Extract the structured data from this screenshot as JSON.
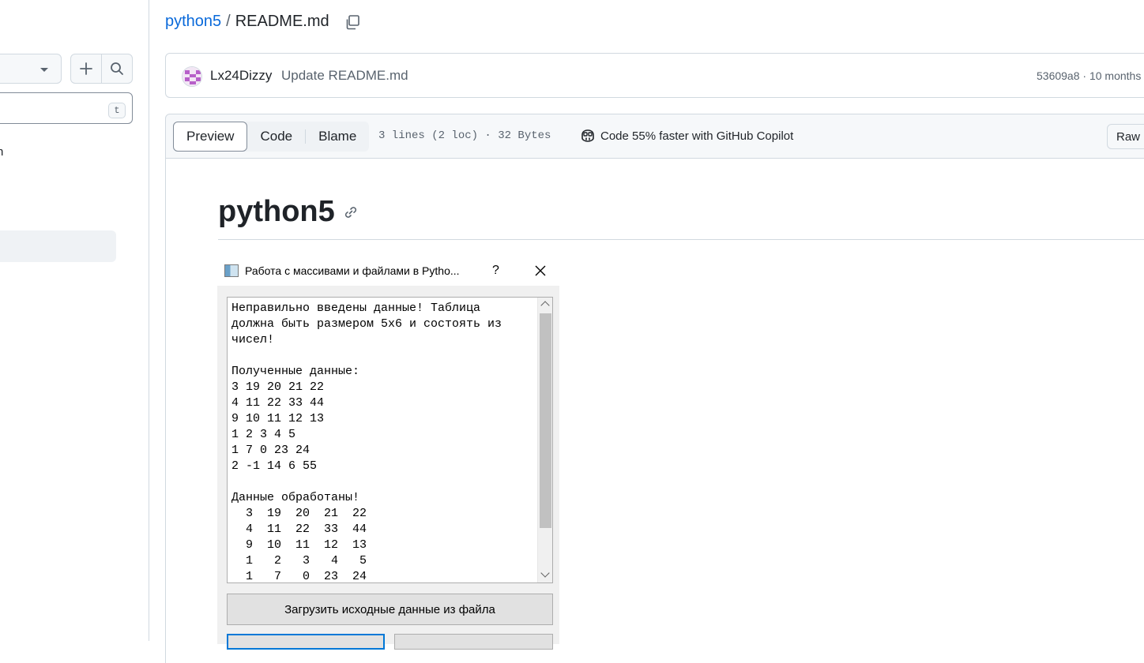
{
  "sidebar": {
    "filter_shortcut": "t",
    "partial_item_text": "n"
  },
  "breadcrumb": {
    "repo": "python5",
    "separator": "/",
    "file": "README.md"
  },
  "commit": {
    "author": "Lx24Dizzy",
    "message": "Update README.md",
    "meta": "53609a8 · 10 months"
  },
  "file_header": {
    "tabs": [
      "Preview",
      "Code",
      "Blame"
    ],
    "active_tab": "Preview",
    "info": "3 lines (2 loc) · 32 Bytes",
    "copilot_text": "Code 55% faster with GitHub Copilot",
    "raw_label": "Raw"
  },
  "readme": {
    "heading": "python5"
  },
  "app_window": {
    "title": "Работа с массивами и файлами в Pytho...",
    "help_label": "?",
    "output_text": "Неправильно введены данные! Таблица\nдолжна быть размером 5x6 и состоять из\nчисел!\n\nПолученные данные:\n3 19 20 21 22\n4 11 22 33 44\n9 10 11 12 13\n1 2 3 4 5\n1 7 0 23 24\n2 -1 14 6 55\n\nДанные обработаны!\n  3  19  20  21  22\n  4  11  22  33  44\n  9  10  11  12  13\n  1   2   3   4   5\n  1   7   0  23  24",
    "load_button": "Загрузить исходные данные из файла"
  }
}
